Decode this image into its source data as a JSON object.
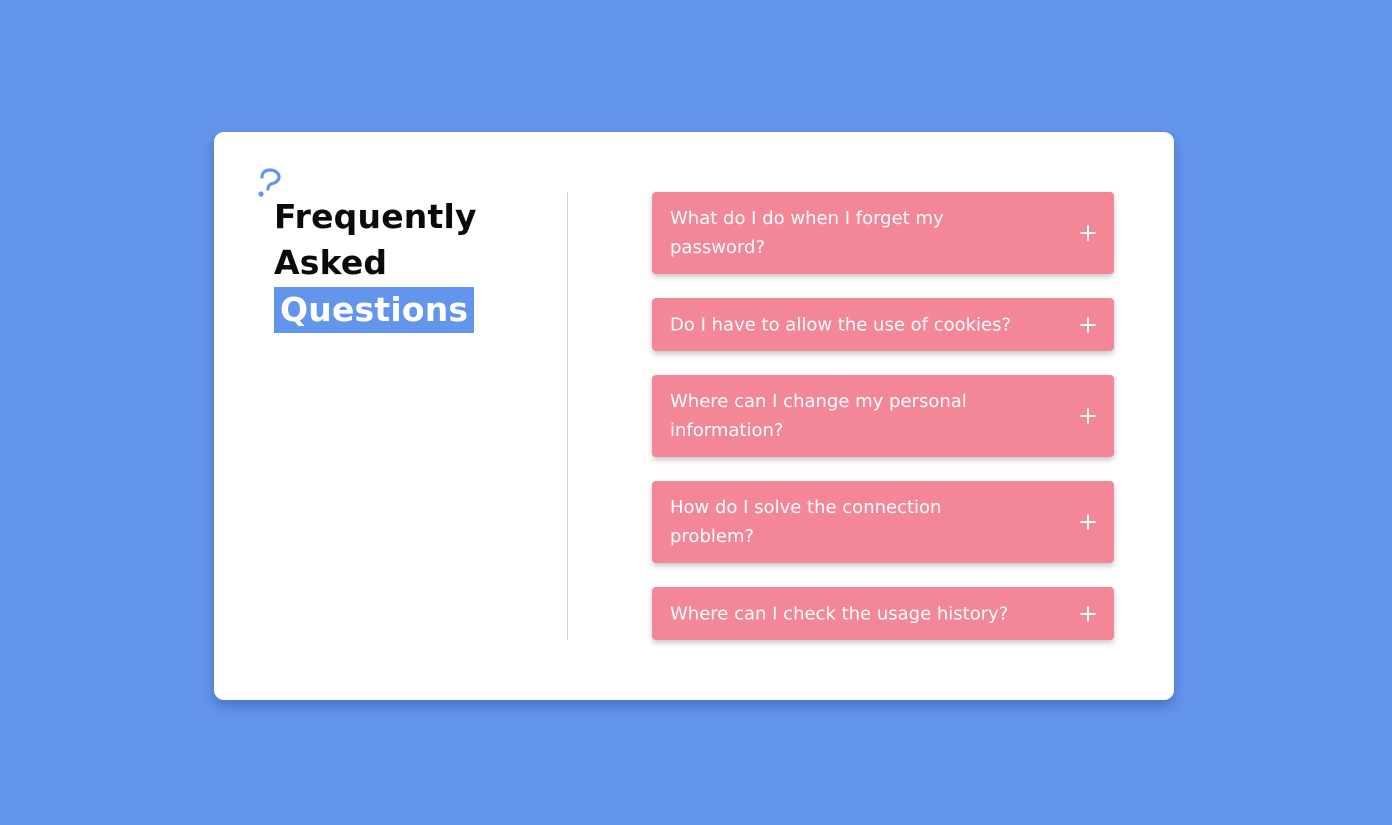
{
  "colors": {
    "background": "#6495ed",
    "card": "#ffffff",
    "accent": "#6495ed",
    "faq_item": "#f48797",
    "faq_text": "#ffffff",
    "heading_text": "#0a0a0a"
  },
  "header": {
    "icon": "question-mark-icon",
    "title_line1": "Frequently",
    "title_line2": "Asked",
    "title_highlight": "Questions"
  },
  "faq": {
    "items": [
      {
        "question": "What do I do when I forget my password?",
        "icon": "plus-icon"
      },
      {
        "question": "Do I have to allow the use of cookies?",
        "icon": "plus-icon"
      },
      {
        "question": "Where can I change my personal information?",
        "icon": "plus-icon"
      },
      {
        "question": "How do I solve the connection problem?",
        "icon": "plus-icon"
      },
      {
        "question": "Where can I check the usage history?",
        "icon": "plus-icon"
      }
    ]
  }
}
